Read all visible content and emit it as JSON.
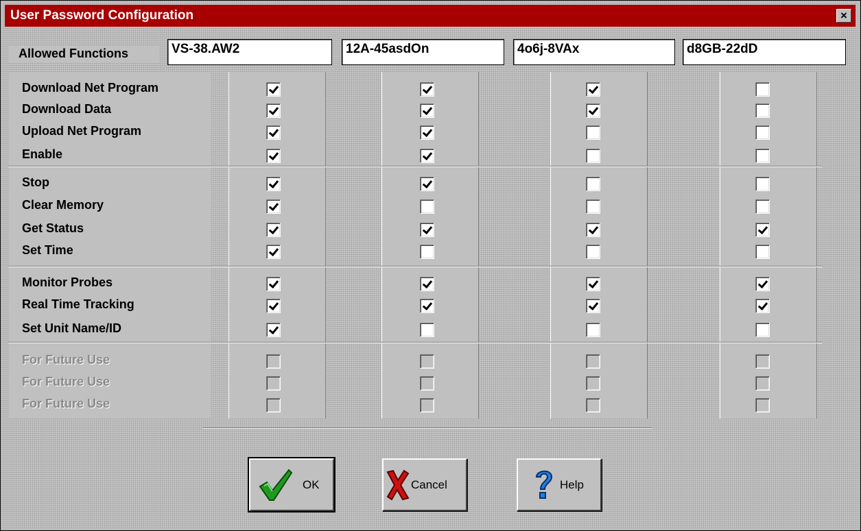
{
  "window": {
    "title": "User Password Configuration"
  },
  "header": {
    "label": "Allowed Functions",
    "passwords": [
      "VS-38.AW2",
      "12A-45asdOn",
      "4o6j-8VAx",
      "d8GB-22dD"
    ]
  },
  "rows": [
    {
      "label": "Download Net Program",
      "enabled": true,
      "checks": [
        true,
        true,
        true,
        false
      ]
    },
    {
      "label": "Download Data",
      "enabled": true,
      "checks": [
        true,
        true,
        true,
        false
      ]
    },
    {
      "label": "Upload Net Program",
      "enabled": true,
      "checks": [
        true,
        true,
        false,
        false
      ]
    },
    {
      "label": "Enable",
      "enabled": true,
      "checks": [
        true,
        true,
        false,
        false
      ]
    },
    {
      "label": "Stop",
      "enabled": true,
      "checks": [
        true,
        true,
        false,
        false
      ]
    },
    {
      "label": "Clear Memory",
      "enabled": true,
      "checks": [
        true,
        false,
        false,
        false
      ]
    },
    {
      "label": "Get Status",
      "enabled": true,
      "checks": [
        true,
        true,
        true,
        true
      ]
    },
    {
      "label": "Set Time",
      "enabled": true,
      "checks": [
        true,
        false,
        false,
        false
      ]
    },
    {
      "label": "Monitor Probes",
      "enabled": true,
      "checks": [
        true,
        true,
        true,
        true
      ]
    },
    {
      "label": "Real Time Tracking",
      "enabled": true,
      "checks": [
        true,
        true,
        true,
        true
      ]
    },
    {
      "label": "Set Unit Name/ID",
      "enabled": true,
      "checks": [
        true,
        false,
        false,
        false
      ]
    },
    {
      "label": "For Future Use",
      "enabled": false,
      "checks": [
        false,
        false,
        false,
        false
      ]
    },
    {
      "label": "For Future Use",
      "enabled": false,
      "checks": [
        false,
        false,
        false,
        false
      ]
    },
    {
      "label": "For Future Use",
      "enabled": false,
      "checks": [
        false,
        false,
        false,
        false
      ]
    }
  ],
  "buttons": {
    "ok": "OK",
    "cancel": "Cancel",
    "help": "Help"
  },
  "icons": {
    "close": "close-icon",
    "ok": "green-checkmark-icon",
    "cancel": "red-x-icon",
    "help": "question-mark-icon"
  },
  "colors": {
    "titlebar": "#a80000",
    "checkmark_green": "#1f9a1f",
    "cancel_red": "#d01010",
    "help_blue": "#2080e0"
  }
}
